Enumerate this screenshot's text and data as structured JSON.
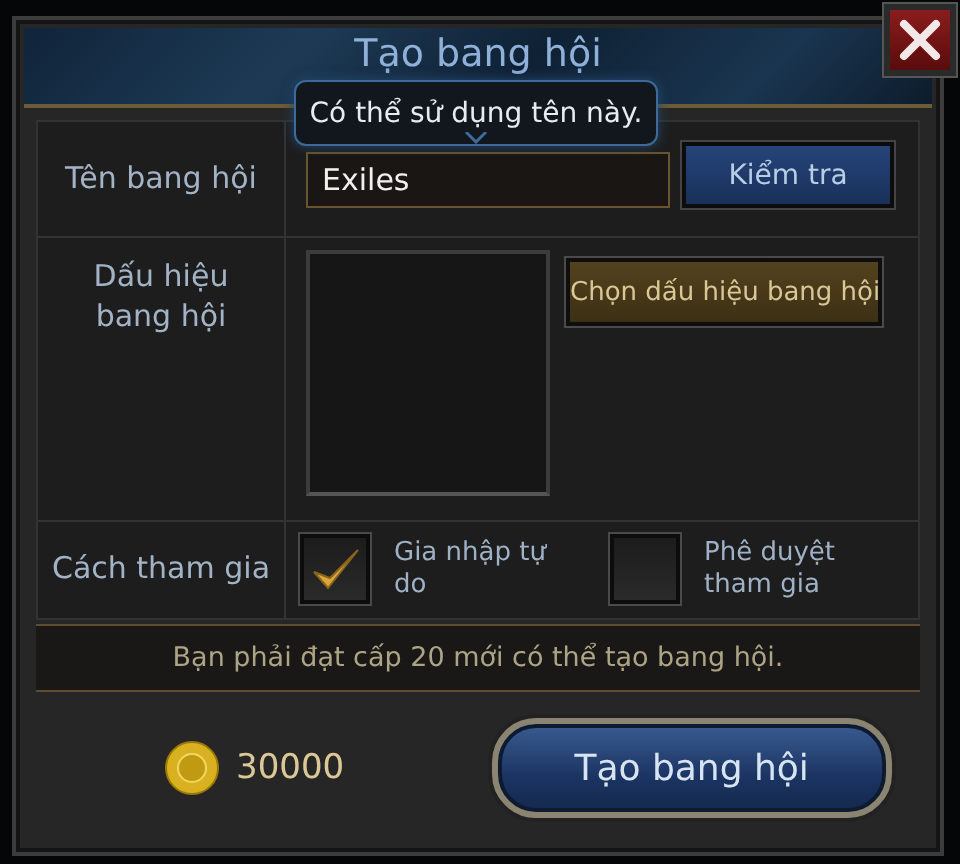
{
  "window": {
    "title": "Tạo bang hội"
  },
  "tooltip": "Có thể sử dụng tên này.",
  "name_row": {
    "label": "Tên bang hội",
    "value": "Exiles",
    "button": "Kiểm tra"
  },
  "emblem_row": {
    "label": "Dấu hiệu bang hội",
    "button": "Chọn dấu hiệu bang hội"
  },
  "join_row": {
    "label": "Cách tham gia",
    "options": [
      {
        "label": "Gia nhập tự do",
        "checked": true
      },
      {
        "label": "Phê duyệt tham gia",
        "checked": false
      }
    ]
  },
  "notice": "Bạn phải đạt cấp 20 mới có thể tạo bang hội.",
  "cost": "30000",
  "create_button": "Tạo bang hội"
}
